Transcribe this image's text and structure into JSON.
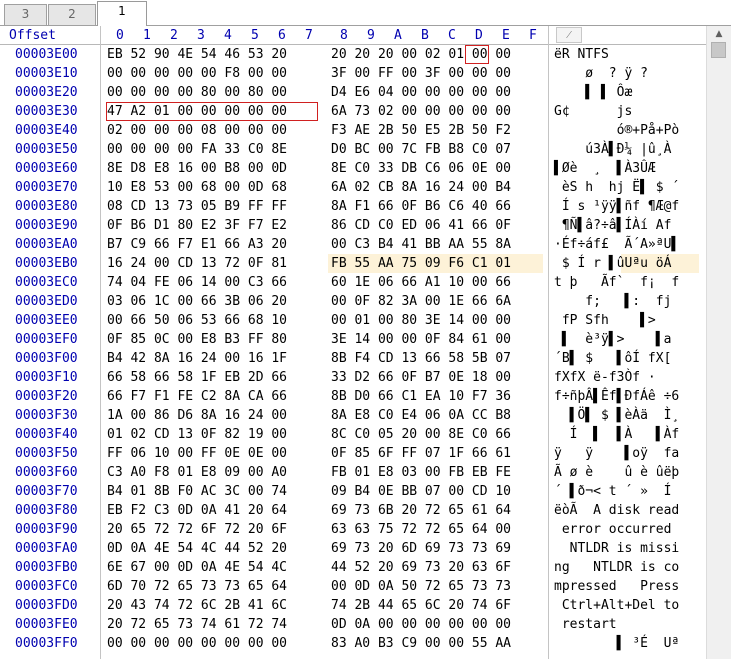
{
  "tabs": [
    "3",
    "2",
    "1"
  ],
  "active_tab": "1",
  "header": {
    "offset": "Offset",
    "cols_left": [
      "0",
      "1",
      "2",
      "3",
      "4",
      "5",
      "6",
      "7"
    ],
    "cols_right": [
      "8",
      "9",
      "A",
      "B",
      "C",
      "D",
      "E",
      "F"
    ],
    "ascii_button": "⁄"
  },
  "rows": [
    {
      "offset": "00003E00",
      "left": "EB 52 90 4E 54 46 53 20",
      "right": "20 20 20 00 02 01 00 00",
      "ascii": "ëR NTFS"
    },
    {
      "offset": "00003E10",
      "left": "00 00 00 00 00 F8 00 00",
      "right": "3F 00 FF 00 3F 00 00 00",
      "ascii": "    ø  ? ÿ ?"
    },
    {
      "offset": "00003E20",
      "left": "00 00 00 00 80 00 80 00",
      "right": "D4 E6 04 00 00 00 00 00",
      "ascii": "    ▌ ▌ Ôæ"
    },
    {
      "offset": "00003E30",
      "left": "47 A2 01 00 00 00 00 00",
      "right": "6A 73 02 00 00 00 00 00",
      "ascii": "G¢      js"
    },
    {
      "offset": "00003E40",
      "left": "02 00 00 00 08 00 00 00",
      "right": "F3 AE 2B 50 E5 2B 50 F2",
      "ascii": "        ó®+På+Pò"
    },
    {
      "offset": "00003E50",
      "left": "00 00 00 00 FA 33 C0 8E",
      "right": "D0 BC 00 7C FB B8 C0 07",
      "ascii": "    ú3À▌Ð¼ |û¸À"
    },
    {
      "offset": "00003E60",
      "left": "8E D8 E8 16 00 B8 00 0D",
      "right": "8E C0 33 DB C6 06 0E 00",
      "ascii": "▌Øè  ¸  ▌À3ÛÆ"
    },
    {
      "offset": "00003E70",
      "left": "10 E8 53 00 68 00 0D 68",
      "right": "6A 02 CB 8A 16 24 00 B4",
      "ascii": " èS h  hj Ë▌ $ ´"
    },
    {
      "offset": "00003E80",
      "left": "08 CD 13 73 05 B9 FF FF",
      "right": "8A F1 66 0F B6 C6 40 66",
      "ascii": " Í s ¹ÿÿ▌ñf ¶Æ@f"
    },
    {
      "offset": "00003E90",
      "left": "0F B6 D1 80 E2 3F F7 E2",
      "right": "86 CD C0 ED 06 41 66 0F",
      "ascii": " ¶Ñ▌â?÷â▌ÍÀí Af"
    },
    {
      "offset": "00003EA0",
      "left": "B7 C9 66 F7 E1 66 A3 20",
      "right": "00 C3 B4 41 BB AA 55 8A",
      "ascii": "·Éf÷áf£  Ã´A»ªU▌"
    },
    {
      "offset": "00003EB0",
      "left": "16 24 00 CD 13 72 0F 81",
      "right": "FB 55 AA 75 09 F6 C1 01",
      "ascii": " $ Í r ▌ûUªu öÁ"
    },
    {
      "offset": "00003EC0",
      "left": "74 04 FE 06 14 00 C3 66",
      "right": "60 1E 06 66 A1 10 00 66",
      "ascii": "t þ   Ãf`  f¡  f"
    },
    {
      "offset": "00003ED0",
      "left": "03 06 1C 00 66 3B 06 20",
      "right": "00 0F 82 3A 00 1E 66 6A",
      "ascii": "    f;   ▌:  fj"
    },
    {
      "offset": "00003EE0",
      "left": "00 66 50 06 53 66 68 10",
      "right": "00 01 00 80 3E 14 00 00",
      "ascii": " fP Sfh    ▌>"
    },
    {
      "offset": "00003EF0",
      "left": "0F 85 0C 00 E8 B3 FF 80",
      "right": "3E 14 00 00 0F 84 61 00",
      "ascii": " ▌  è³ÿ▌>    ▌a"
    },
    {
      "offset": "00003F00",
      "left": "B4 42 8A 16 24 00 16 1F",
      "right": "8B F4 CD 13 66 58 5B 07",
      "ascii": "´B▌ $   ▌ôÍ fX["
    },
    {
      "offset": "00003F10",
      "left": "66 58 66 58 1F EB 2D 66",
      "right": "33 D2 66 0F B7 0E 18 00",
      "ascii": "fXfX ë-f3Òf ·"
    },
    {
      "offset": "00003F20",
      "left": "66 F7 F1 FE C2 8A CA 66",
      "right": "8B D0 66 C1 EA 10 F7 36",
      "ascii": "f÷ñþÂ▌Êf▌ÐfÁê ÷6"
    },
    {
      "offset": "00003F30",
      "left": "1A 00 86 D6 8A 16 24 00",
      "right": "8A E8 C0 E4 06 0A CC B8",
      "ascii": "  ▌Ö▌ $ ▌èÀä  Ì¸"
    },
    {
      "offset": "00003F40",
      "left": "01 02 CD 13 0F 82 19 00",
      "right": "8C C0 05 20 00 8E C0 66",
      "ascii": "  Í  ▌  ▌À   ▌Àf"
    },
    {
      "offset": "00003F50",
      "left": "FF 06 10 00 FF 0E 0E 00",
      "right": "0F 85 6F FF 07 1F 66 61",
      "ascii": "ÿ   ÿ    ▌oÿ  fa"
    },
    {
      "offset": "00003F60",
      "left": "C3 A0 F8 01 E8 09 00 A0",
      "right": "FB 01 E8 03 00 FB EB FE",
      "ascii": "Ã ø è    û è ûëþ"
    },
    {
      "offset": "00003F70",
      "left": "B4 01 8B F0 AC 3C 00 74",
      "right": "09 B4 0E BB 07 00 CD 10",
      "ascii": "´ ▌ð¬< t ´ »  Í"
    },
    {
      "offset": "00003F80",
      "left": "EB F2 C3 0D 0A 41 20 64",
      "right": "69 73 6B 20 72 65 61 64",
      "ascii": "ëòÃ  A disk read"
    },
    {
      "offset": "00003F90",
      "left": "20 65 72 72 6F 72 20 6F",
      "right": "63 63 75 72 72 65 64 00",
      "ascii": " error occurred"
    },
    {
      "offset": "00003FA0",
      "left": "0D 0A 4E 54 4C 44 52 20",
      "right": "69 73 20 6D 69 73 73 69",
      "ascii": "  NTLDR is missi"
    },
    {
      "offset": "00003FB0",
      "left": "6E 67 00 0D 0A 4E 54 4C",
      "right": "44 52 20 69 73 20 63 6F",
      "ascii": "ng   NTLDR is co"
    },
    {
      "offset": "00003FC0",
      "left": "6D 70 72 65 73 73 65 64",
      "right": "00 0D 0A 50 72 65 73 73",
      "ascii": "mpressed   Press"
    },
    {
      "offset": "00003FD0",
      "left": "20 43 74 72 6C 2B 41 6C",
      "right": "74 2B 44 65 6C 20 74 6F",
      "ascii": " Ctrl+Alt+Del to"
    },
    {
      "offset": "00003FE0",
      "left": "20 72 65 73 74 61 72 74",
      "right": "0D 0A 00 00 00 00 00 00",
      "ascii": " restart"
    },
    {
      "offset": "00003FF0",
      "left": "00 00 00 00 00 00 00 00",
      "right": "83 A0 B3 C9 00 00 55 AA",
      "ascii": "        ▌ ³É  Uª"
    }
  ],
  "highlight_row": "00003EB0"
}
